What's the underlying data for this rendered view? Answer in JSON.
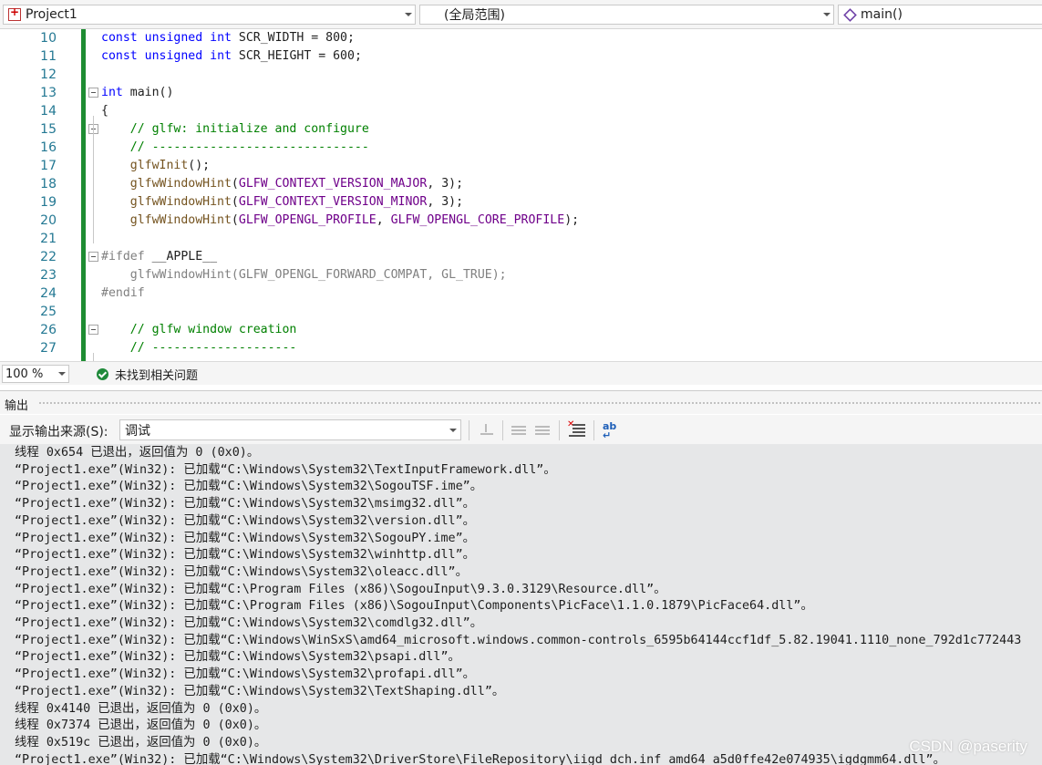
{
  "navbar": {
    "project": "Project1",
    "scope": "(全局范围)",
    "member": "main()"
  },
  "editor": {
    "lines": [
      {
        "num": "10",
        "code": "const unsigned int SCR_WIDTH = 800;"
      },
      {
        "num": "11",
        "code": "const unsigned int SCR_HEIGHT = 600;"
      },
      {
        "num": "12",
        "code": ""
      },
      {
        "num": "13",
        "code": "int main()"
      },
      {
        "num": "14",
        "code": "{"
      },
      {
        "num": "15",
        "code": "    // glfw: initialize and configure"
      },
      {
        "num": "16",
        "code": "    // ------------------------------"
      },
      {
        "num": "17",
        "code": "    glfwInit();"
      },
      {
        "num": "18",
        "code": "    glfwWindowHint(GLFW_CONTEXT_VERSION_MAJOR, 3);"
      },
      {
        "num": "19",
        "code": "    glfwWindowHint(GLFW_CONTEXT_VERSION_MINOR, 3);"
      },
      {
        "num": "20",
        "code": "    glfwWindowHint(GLFW_OPENGL_PROFILE, GLFW_OPENGL_CORE_PROFILE);"
      },
      {
        "num": "21",
        "code": ""
      },
      {
        "num": "22",
        "code": "#ifdef __APPLE__"
      },
      {
        "num": "23",
        "code": "    glfwWindowHint(GLFW_OPENGL_FORWARD_COMPAT, GL_TRUE);"
      },
      {
        "num": "24",
        "code": "#endif"
      },
      {
        "num": "25",
        "code": ""
      },
      {
        "num": "26",
        "code": "    // glfw window creation"
      },
      {
        "num": "27",
        "code": "    // --------------------"
      }
    ]
  },
  "status": {
    "zoom": "100 %",
    "issues": "未找到相关问题"
  },
  "output": {
    "title": "输出",
    "source_label": "显示输出来源(S):",
    "source_value": "调试",
    "lines": [
      "线程 0x654 已退出，返回值为 0 (0x0)。",
      "“Project1.exe”(Win32): 已加载“C:\\Windows\\System32\\TextInputFramework.dll”。",
      "“Project1.exe”(Win32): 已加载“C:\\Windows\\System32\\SogouTSF.ime”。",
      "“Project1.exe”(Win32): 已加载“C:\\Windows\\System32\\msimg32.dll”。",
      "“Project1.exe”(Win32): 已加载“C:\\Windows\\System32\\version.dll”。",
      "“Project1.exe”(Win32): 已加载“C:\\Windows\\System32\\SogouPY.ime”。",
      "“Project1.exe”(Win32): 已加载“C:\\Windows\\System32\\winhttp.dll”。",
      "“Project1.exe”(Win32): 已加载“C:\\Windows\\System32\\oleacc.dll”。",
      "“Project1.exe”(Win32): 已加载“C:\\Program Files (x86)\\SogouInput\\9.3.0.3129\\Resource.dll”。",
      "“Project1.exe”(Win32): 已加载“C:\\Program Files (x86)\\SogouInput\\Components\\PicFace\\1.1.0.1879\\PicFace64.dll”。",
      "“Project1.exe”(Win32): 已加载“C:\\Windows\\System32\\comdlg32.dll”。",
      "“Project1.exe”(Win32): 已加载“C:\\Windows\\WinSxS\\amd64_microsoft.windows.common-controls_6595b64144ccf1df_5.82.19041.1110_none_792d1c772443",
      "“Project1.exe”(Win32): 已加载“C:\\Windows\\System32\\psapi.dll”。",
      "“Project1.exe”(Win32): 已加载“C:\\Windows\\System32\\profapi.dll”。",
      "“Project1.exe”(Win32): 已加载“C:\\Windows\\System32\\TextShaping.dll”。",
      "线程 0x4140 已退出，返回值为 0 (0x0)。",
      "线程 0x7374 已退出，返回值为 0 (0x0)。",
      "线程 0x519c 已退出，返回值为 0 (0x0)。",
      "“Project1.exe”(Win32): 已加载“C:\\Windows\\System32\\DriverStore\\FileRepository\\iigd_dch.inf_amd64_a5d0ffe42e074935\\igdgmm64.dll”。"
    ]
  },
  "watermark": "CSDN @paserity"
}
